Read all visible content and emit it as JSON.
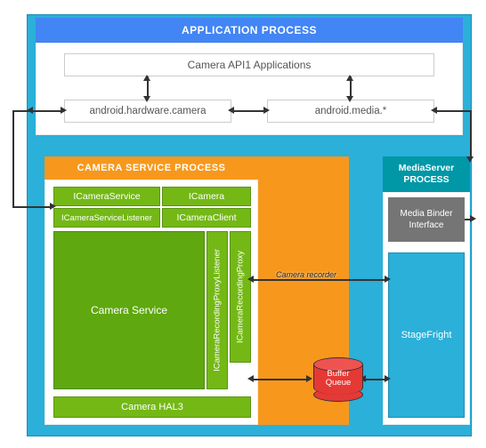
{
  "app_process": {
    "title": "APPLICATION PROCESS",
    "api_apps": "Camera API1 Applications",
    "hw_camera": "android.hardware.camera",
    "media_star": "android.media.*"
  },
  "camera_service_process": {
    "title": "CAMERA SERVICE PROCESS",
    "icamera_service": "ICameraService",
    "icamera": "ICamera",
    "icamera_service_listener": "ICameraServiceListener",
    "icamera_client": "ICameraClient",
    "rec_proxy_listener": "ICameraRecordingProxyListener",
    "rec_proxy": "ICameraRecordingProxy",
    "camera_service": "Camera Service",
    "hal3": "Camera HAL3"
  },
  "media_server_process": {
    "title": "MediaServer PROCESS",
    "media_binder": "Media Binder Interface",
    "stagefright": "StageFright"
  },
  "buffer_queue": "Buffer Queue",
  "arrow_labels": {
    "camera_recorder": "Camera recorder"
  }
}
